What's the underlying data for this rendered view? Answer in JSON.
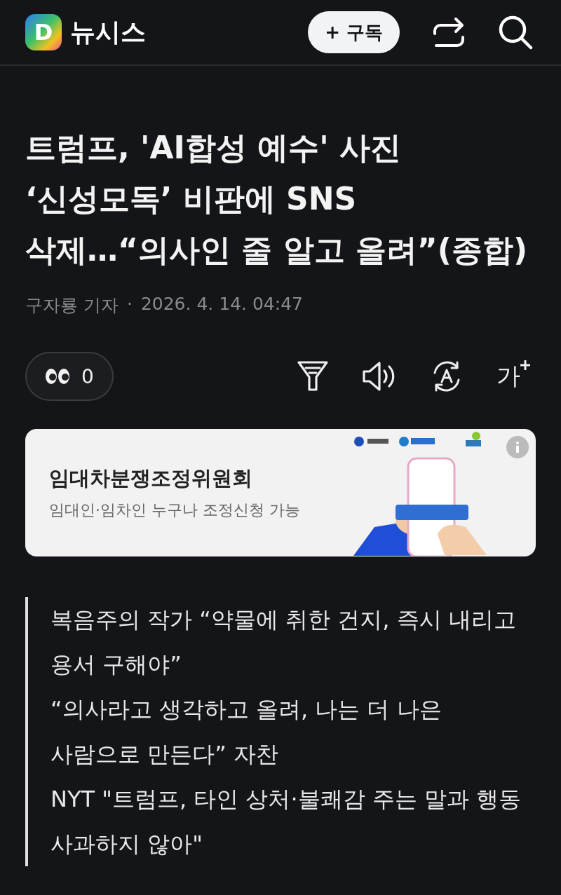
{
  "header": {
    "logo_letter": "D",
    "brand": "뉴시스",
    "subscribe_button": "+ 구독"
  },
  "article": {
    "title": "트럼프, 'AI합성 예수' 사진 ‘신성모독’ 비판에 SNS 삭제…“의사인 줄 알고 올려”(종합)",
    "byline": {
      "author": "구자룡 기자",
      "separator": "·",
      "date": "2026. 4. 14. 04:47"
    },
    "reactions": {
      "count": "0"
    },
    "text_size_label": "가"
  },
  "ad": {
    "title": "임대차분쟁조정위원회",
    "subtitle": "임대인·임차인 누구나 조정신청 가능"
  },
  "summary": [
    "복음주의 작가 “약물에 취한 건지, 즉시 내리고 용서 구해야”",
    "“의사라고 생각하고 올려, 나는 더 나은 사람으로 만든다” 자찬",
    "NYT \"트럼프, 타인 상처·불쾌감 주는 말과 행동 사과하지 않아\""
  ]
}
